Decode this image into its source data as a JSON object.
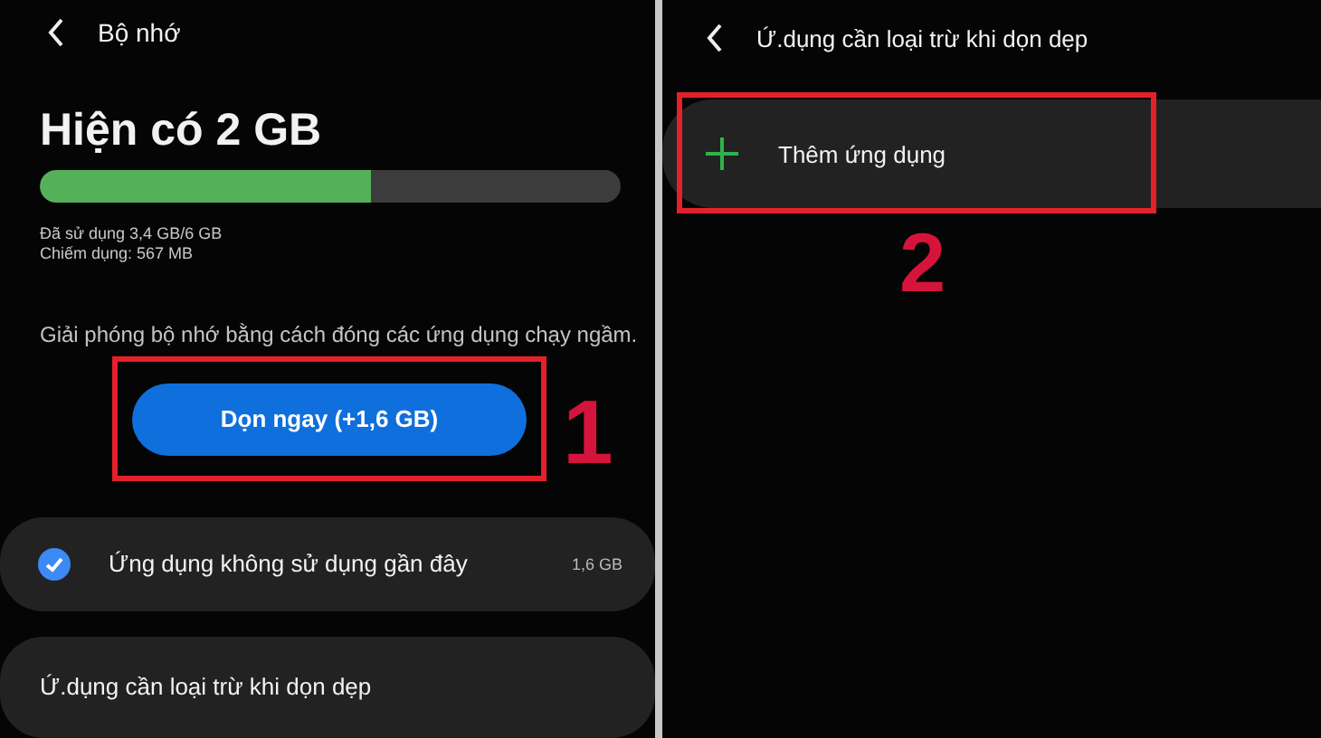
{
  "left_screen": {
    "title": "Bộ nhớ",
    "available": "Hiện có 2 GB",
    "usage_bar": {
      "level": 0.57
    },
    "used": "Đã sử dụng 3,4 GB/6 GB",
    "occupied": "Chiếm dụng: 567 MB",
    "description": "Giải phóng bộ nhớ bằng cách đóng các ứng dụng chạy ngầm.",
    "clean_button": "Dọn ngay (+1,6 GB)",
    "options": [
      {
        "kind": "checkbox",
        "label": "Ứng dụng không sử dụng gần đây",
        "checked": true,
        "size": "1,6 GB"
      },
      {
        "kind": "link",
        "label": "Ứ.dụng cần loại trừ khi dọn dẹp"
      }
    ]
  },
  "right_screen": {
    "title": "Ứ.dụng cần loại trừ khi dọn dẹp",
    "add_button": "Thêm ứng dụng"
  },
  "annotations": [
    {
      "label": "1"
    },
    {
      "label": "2"
    }
  ]
}
